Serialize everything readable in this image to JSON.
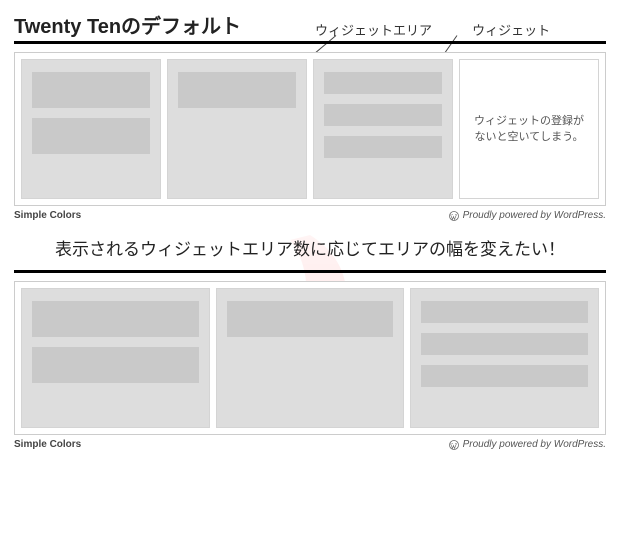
{
  "titles": {
    "main": "Twenty Tenのデフォルト",
    "middle": "表示されるウィジェットエリア数に応じてエリアの幅を変えたい！"
  },
  "labels": {
    "widget_area": "ウィジェットエリア",
    "widget": "ウィジェット"
  },
  "note": {
    "empty_area": "ウィジェットの登録がないと空いてしまう。"
  },
  "footer": {
    "left": "Simple Colors",
    "right": "Proudly powered by WordPress."
  },
  "diagram": {
    "top": {
      "columns": 4,
      "areas": [
        {
          "widgets": [
            36,
            36
          ],
          "empty": false
        },
        {
          "widgets": [
            36
          ],
          "empty": false
        },
        {
          "widgets": [
            22,
            22,
            22
          ],
          "empty": false
        },
        {
          "widgets": [],
          "empty": true
        }
      ]
    },
    "bottom": {
      "columns": 3,
      "areas": [
        {
          "widgets": [
            36,
            36
          ],
          "empty": false
        },
        {
          "widgets": [
            36
          ],
          "empty": false
        },
        {
          "widgets": [
            22,
            22,
            22
          ],
          "empty": false
        }
      ]
    }
  }
}
